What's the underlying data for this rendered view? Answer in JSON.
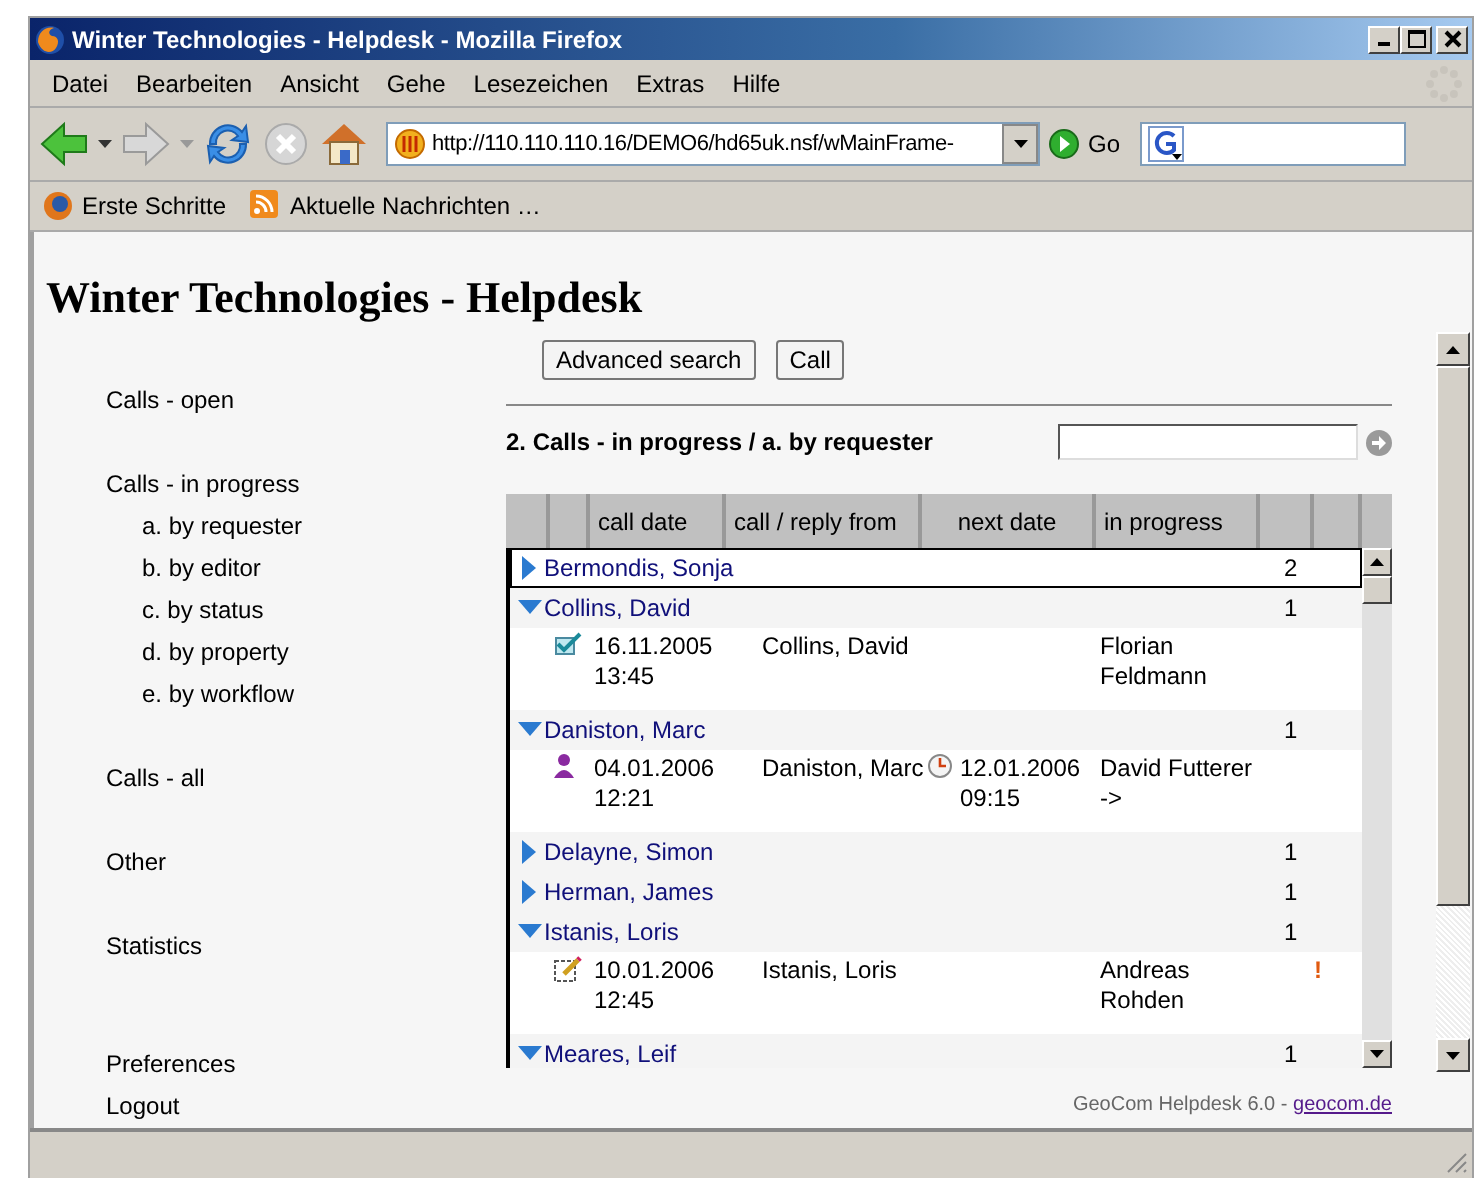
{
  "window": {
    "title": "Winter Technologies - Helpdesk - Mozilla Firefox"
  },
  "menu": [
    "Datei",
    "Bearbeiten",
    "Ansicht",
    "Gehe",
    "Lesezeichen",
    "Extras",
    "Hilfe"
  ],
  "toolbar": {
    "url": "http://110.110.110.16/DEMO6/hd65uk.nsf/wMainFrame-",
    "go": "Go"
  },
  "bookmarks": [
    "Erste Schritte",
    "Aktuelle Nachrichten …"
  ],
  "page": {
    "title": "Winter Technologies - Helpdesk",
    "nav": [
      {
        "label": "Calls - open"
      },
      {
        "label": "Calls - in progress",
        "children": [
          {
            "label": "a. by requester"
          },
          {
            "label": "b. by editor"
          },
          {
            "label": "c. by status"
          },
          {
            "label": "d. by property"
          },
          {
            "label": "e. by workflow"
          }
        ]
      },
      {
        "label": "Calls - all"
      },
      {
        "label": "Other"
      },
      {
        "label": "Statistics"
      }
    ],
    "nav_bottom": [
      "Preferences",
      "Logout"
    ],
    "buttons": [
      "Advanced search",
      "Call"
    ],
    "view_title": "2. Calls - in progress / a. by requester",
    "table": {
      "columns": [
        "call date",
        "call / reply from",
        "next date",
        "in progress"
      ],
      "groups": [
        {
          "name": "Bermondis, Sonja",
          "count": "2",
          "expanded": false,
          "selected": true
        },
        {
          "name": "Collins, David",
          "count": "1",
          "expanded": true,
          "selected": false,
          "calls": [
            {
              "kind": "done",
              "call_date": "16.11.2005 13:45",
              "from": "Collins, David",
              "in_progress": "Florian Feldmann"
            }
          ]
        },
        {
          "name": "Daniston, Marc",
          "count": "1",
          "expanded": true,
          "selected": false,
          "calls": [
            {
              "kind": "person",
              "call_date": "04.01.2006 12:21",
              "from": "Daniston, Marc",
              "next_date": "12.01.2006 09:15",
              "in_progress": "David Futterer ->"
            }
          ]
        },
        {
          "name": "Delayne, Simon",
          "count": "1",
          "expanded": false,
          "selected": false
        },
        {
          "name": "Herman, James",
          "count": "1",
          "expanded": false,
          "selected": false
        },
        {
          "name": "Istanis, Loris",
          "count": "1",
          "expanded": true,
          "selected": false,
          "calls": [
            {
              "kind": "edit",
              "call_date": "10.01.2006 12:45",
              "from": "Istanis, Loris",
              "in_progress": "Andreas Rohden",
              "priority": "!"
            }
          ]
        },
        {
          "name": "Meares, Leif",
          "count": "1",
          "expanded": true,
          "selected": false
        }
      ]
    },
    "footer": {
      "text": "GeoCom Helpdesk 6.0 -",
      "link": "geocom.de"
    }
  }
}
